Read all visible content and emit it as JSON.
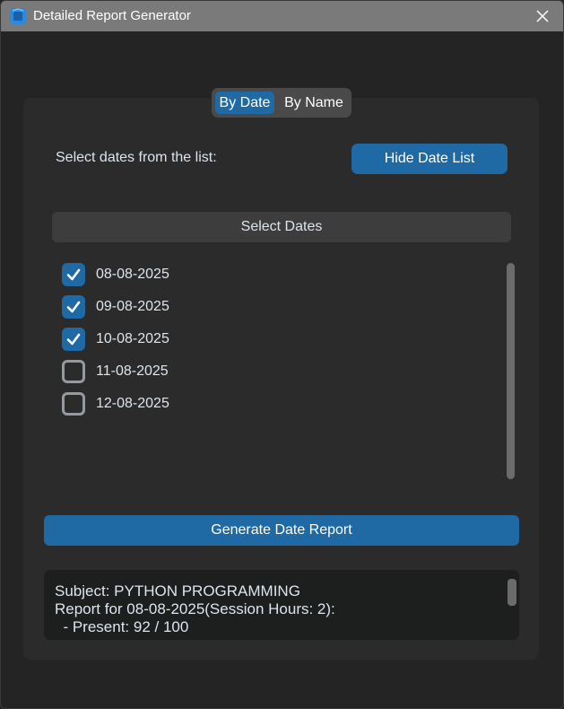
{
  "window": {
    "title": "Detailed Report Generator"
  },
  "tabs": [
    {
      "label": "By Date",
      "active": true
    },
    {
      "label": "By Name",
      "active": false
    }
  ],
  "date_section": {
    "instruction": "Select dates from the list:",
    "hide_button_label": "Hide Date List",
    "list_header": "Select Dates",
    "dates": [
      {
        "label": "08-08-2025",
        "checked": true
      },
      {
        "label": "09-08-2025",
        "checked": true
      },
      {
        "label": "10-08-2025",
        "checked": true
      },
      {
        "label": "11-08-2025",
        "checked": false
      },
      {
        "label": "12-08-2025",
        "checked": false
      }
    ]
  },
  "generate_button_label": "Generate Date Report",
  "report": {
    "lines": [
      "Subject: PYTHON PROGRAMMING",
      "Report for 08-08-2025(Session Hours: 2):",
      "  - Present: 92 / 100"
    ]
  },
  "colors": {
    "accent": "#1f6aa5",
    "background": "#242424",
    "frame": "#2b2b2b",
    "titlebar": "#7a7a7a"
  }
}
